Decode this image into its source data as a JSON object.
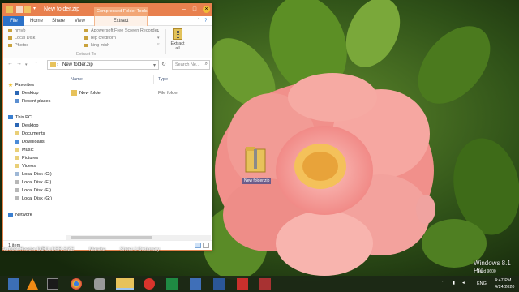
{
  "window": {
    "title": "New folder.zip",
    "context_tab_group": "Compressed Folder Tools",
    "tabs": [
      "File",
      "Home",
      "Share",
      "View",
      "Extract"
    ],
    "ribbon_destinations": [
      "hmvb",
      "Local Disk",
      "Photos",
      "Apowersoft Free Screen Recorder",
      "rep creditorn",
      "king mich"
    ],
    "ribbon_group_label": "Extract To",
    "extract_all_label": "Extract\nall",
    "address_path": "New folder.zip",
    "search_placeholder": "Search Ne...",
    "columns": {
      "name": "Name",
      "type": "Type"
    },
    "files": [
      {
        "name": "New folder",
        "type": "File folder"
      }
    ],
    "status_text": "1 item",
    "nav": {
      "favorites": "Favorites",
      "desktop_fav": "Desktop",
      "recent": "Recent places",
      "this_pc": "This PC",
      "desktop": "Desktop",
      "documents": "Documents",
      "downloads": "Downloads",
      "music": "Music",
      "pictures": "Pictures",
      "videos": "Videos",
      "disk_c": "Local Disk (C:)",
      "disk_e": "Local Disk (E:)",
      "disk_f": "Local Disk (F:)",
      "disk_g": "Local Disk (G:)",
      "network": "Network"
    }
  },
  "desktop": {
    "zip_label": "New folder.zip",
    "watermark": "Windows 8.1 Pro",
    "build_text": "Build 9600",
    "taskbar_labels": [
      "Acrobat Reader DC",
      "FOLDER SIZE",
      "Maraka",
      "Sheet 2 Dictionary"
    ]
  },
  "tray": {
    "lang": "ENG",
    "time": "4:47 PM",
    "date": "4/24/2020"
  },
  "colors": {
    "titlebar": "#e8804e",
    "file_tab": "#2c71c7",
    "folder": "#e7c25b"
  }
}
